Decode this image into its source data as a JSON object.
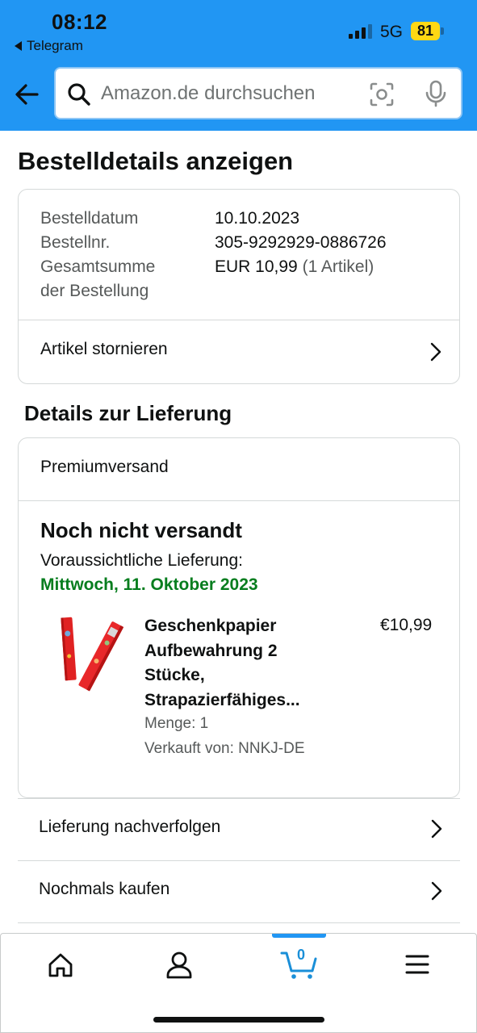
{
  "status_bar": {
    "time": "08:12",
    "back_app": "Telegram",
    "network": "5G",
    "battery": "81"
  },
  "search": {
    "placeholder": "Amazon.de durchsuchen"
  },
  "page": {
    "title": "Bestelldetails anzeigen"
  },
  "order": {
    "date_label": "Bestelldatum",
    "date_value": "10.10.2023",
    "number_label": "Bestellnr.",
    "number_value": "305-9292929-0886726",
    "total_label_line1": "Gesamtsumme",
    "total_label_line2": "der Bestellung",
    "total_value": "EUR 10,99",
    "total_count": "(1 Artikel)",
    "cancel_label": "Artikel stornieren"
  },
  "delivery": {
    "section_title": "Details zur Lieferung",
    "shipping_type": "Premiumversand",
    "status": "Noch nicht versandt",
    "expected_label": "Voraussichtliche Lieferung:",
    "expected_date": "Mittwoch, 11. Oktober 2023",
    "status_color": "#067d1e"
  },
  "product": {
    "title_lines": [
      "Geschenkpapier",
      "Aufbewahrung 2",
      "Stücke,",
      "Strapazierfähiges..."
    ],
    "price": "€10,99",
    "quantity": "Menge: 1",
    "seller": "Verkauft von: NNKJ-DE"
  },
  "actions": {
    "track": "Lieferung nachverfolgen",
    "buy_again": "Nochmals kaufen"
  },
  "bottom_nav": {
    "items": [
      "home-icon",
      "account-icon",
      "cart-icon",
      "menu-icon"
    ],
    "cart_count": "0",
    "active_color": "#2196f3"
  },
  "colors": {
    "header": "#2196f3",
    "battery": "#ffd814"
  }
}
